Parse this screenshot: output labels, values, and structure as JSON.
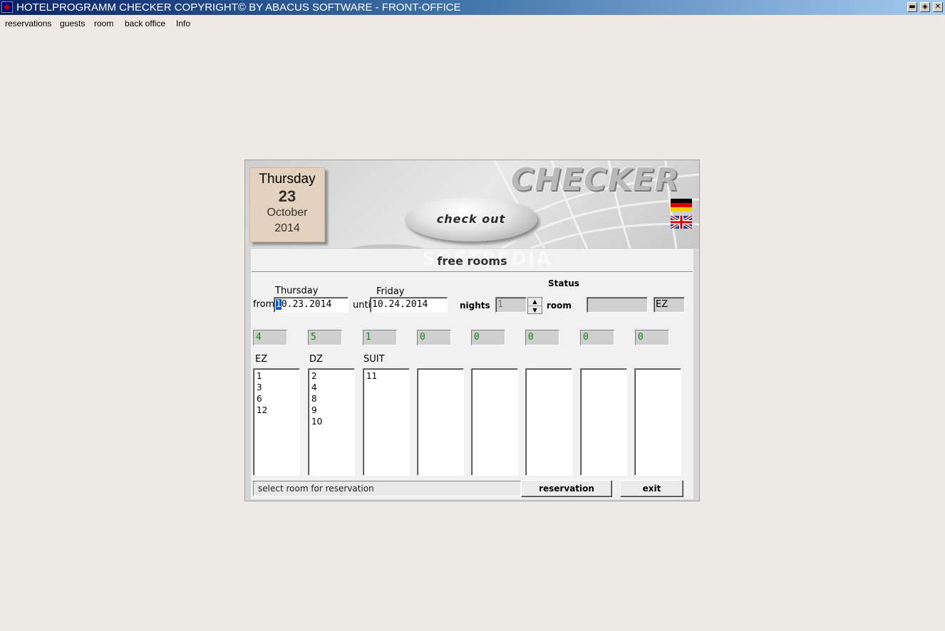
{
  "window": {
    "title": "HOTELPROGRAMM CHECKER COPYRIGHT© BY ABACUS SOFTWARE - FRONT-OFFICE",
    "min_label": "▬",
    "max_label": "◈",
    "close_label": "✕"
  },
  "menu": [
    "reservations",
    "guests",
    "room",
    "back office",
    "Info"
  ],
  "header": {
    "logo": "CHECKER",
    "calendar": {
      "day": "Thursday",
      "date": "23",
      "month": "October",
      "year": "2014"
    },
    "checkout_label": "check out",
    "watermark": "SOFTPEDIA"
  },
  "section_title": "free rooms",
  "form": {
    "from_day": "Thursday",
    "from_label": "from",
    "from_value": "10.23.2014",
    "until_day": "Friday",
    "until_label": "unti",
    "until_value": "10.24.2014",
    "status_label": "Status",
    "nights_label": "nights",
    "nights_value": "1",
    "room_label": "room",
    "room_value": "",
    "room_type": "EZ"
  },
  "counts": [
    "4",
    "5",
    "1",
    "0",
    "0",
    "0",
    "0",
    "0"
  ],
  "categories": [
    "EZ",
    "DZ",
    "SUIT"
  ],
  "lists": [
    [
      "1",
      "3",
      "6",
      "12"
    ],
    [
      "2",
      "4",
      "8",
      "9",
      "10"
    ],
    [
      "11"
    ],
    [],
    [],
    [],
    [],
    []
  ],
  "status_text": "select room for reservation",
  "buttons": {
    "reservation": "reservation",
    "exit": "exit"
  },
  "colors": {
    "count_text": "#13861a",
    "calendar_bg": "#e3d2bd",
    "selection": "#0a58d6"
  }
}
